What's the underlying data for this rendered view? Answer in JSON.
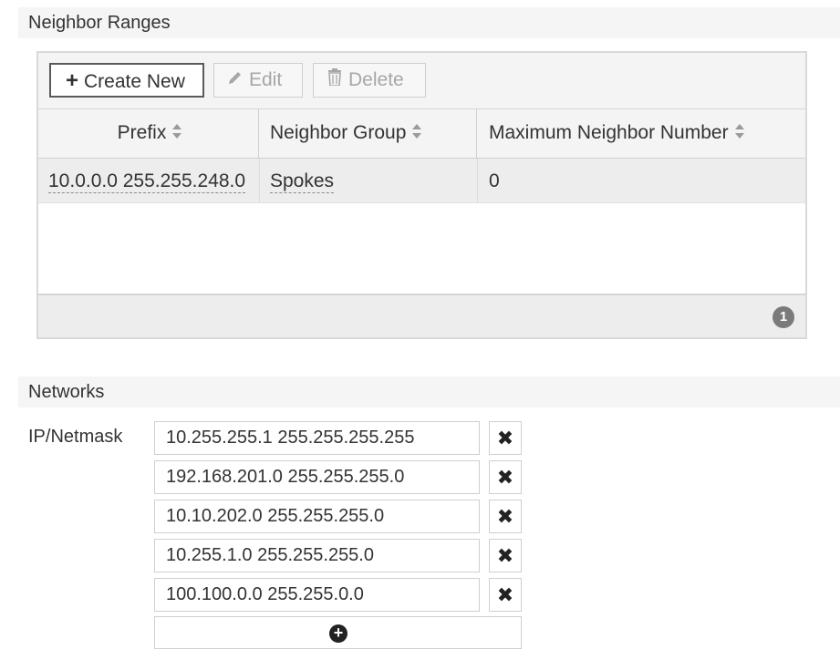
{
  "neighbor_ranges": {
    "title": "Neighbor Ranges",
    "toolbar": {
      "create_label": "Create New",
      "edit_label": "Edit",
      "delete_label": "Delete"
    },
    "columns": [
      "Prefix",
      "Neighbor Group",
      "Maximum Neighbor Number"
    ],
    "rows": [
      {
        "prefix": "10.0.0.0 255.255.248.0",
        "group": "Spokes",
        "max": "0"
      }
    ],
    "page_count": "1"
  },
  "networks": {
    "title": "Networks",
    "ip_label": "IP/Netmask",
    "entries": [
      "10.255.255.1 255.255.255.255",
      "192.168.201.0 255.255.255.0",
      "10.10.202.0 255.255.255.0",
      "10.255.1.0 255.255.255.0",
      "100.100.0.0 255.255.0.0"
    ]
  },
  "icons": {
    "create": "plus-icon",
    "edit": "pencil-icon",
    "delete": "trash-icon",
    "sort": "sort-icon",
    "remove": "close-icon",
    "add": "add-circle-icon"
  }
}
